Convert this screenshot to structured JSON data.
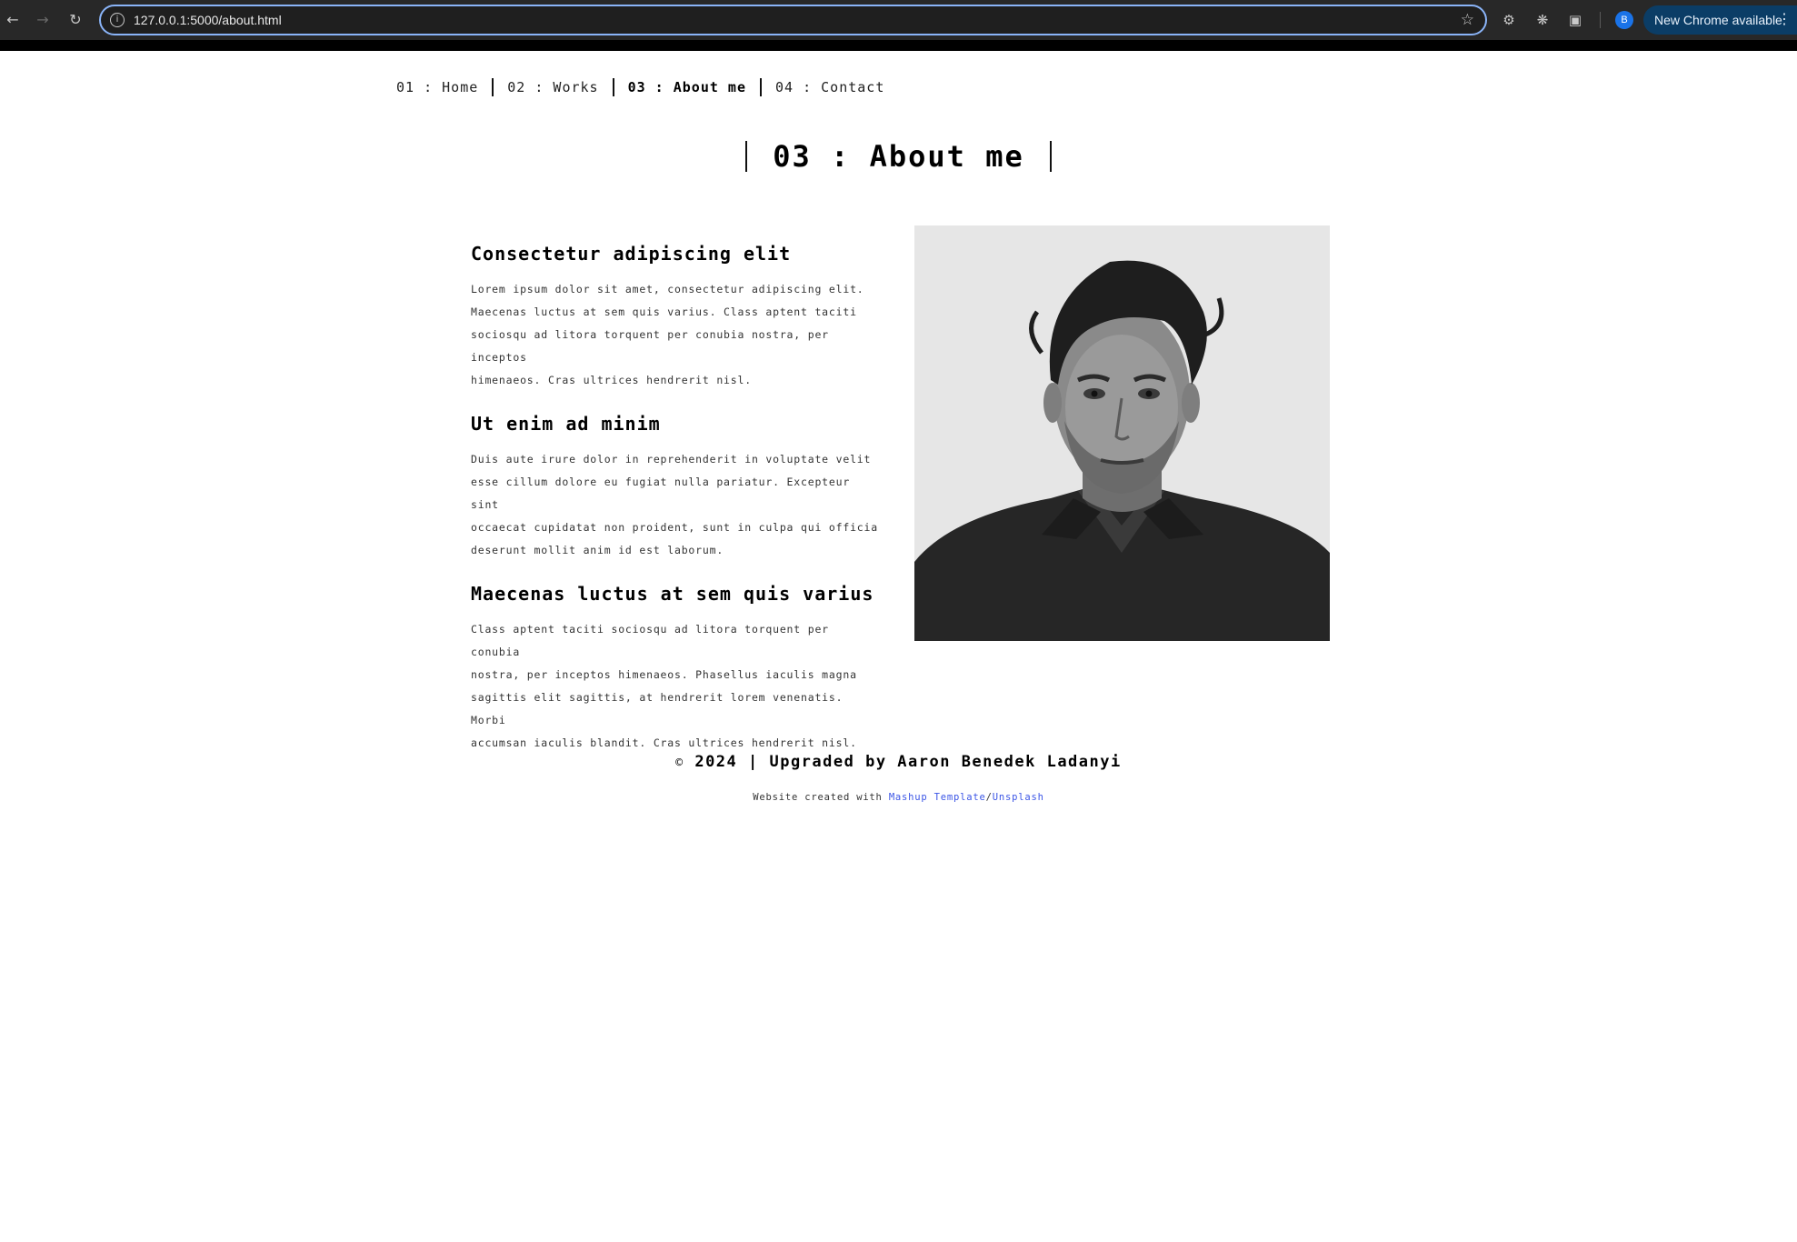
{
  "browser": {
    "url": "127.0.0.1:5000/about.html",
    "profile_initial": "B",
    "update_label": "New Chrome available",
    "icons": {
      "back": "arrow-left-icon",
      "forward": "arrow-right-icon",
      "reload": "reload-icon",
      "site_info": "info-icon",
      "bookmark": "star-icon",
      "extension_1": "gear-icon",
      "extension_2": "puzzle-dots-icon",
      "extensions": "puzzle-icon",
      "menu": "menu-dots-icon"
    },
    "accent_color": "#8ab4f8",
    "update_color": "#0b3d66"
  },
  "nav": {
    "items": [
      {
        "label": "01 : Home",
        "active": false
      },
      {
        "label": "02 : Works",
        "active": false
      },
      {
        "label": "03 : About me",
        "active": true
      },
      {
        "label": "04 : Contact",
        "active": false
      }
    ]
  },
  "page": {
    "title": "03 : About me"
  },
  "sections": [
    {
      "heading": "Consectetur adipiscing elit",
      "body": "Lorem ipsum dolor sit amet, consectetur adipiscing elit.\nMaecenas luctus at sem quis varius. Class aptent taciti\nsociosqu ad litora torquent per conubia nostra, per inceptos\nhimenaeos. Cras ultrices hendrerit nisl."
    },
    {
      "heading": "Ut enim ad minim",
      "body": "Duis aute irure dolor in reprehenderit in voluptate velit\nesse cillum dolore eu fugiat nulla pariatur. Excepteur sint\noccaecat cupidatat non proident, sunt in culpa qui officia\ndeserunt mollit anim id est laborum."
    },
    {
      "heading": "Maecenas luctus at sem quis varius",
      "body": "Class aptent taciti sociosqu ad litora torquent per conubia\nnostra, per inceptos himenaeos. Phasellus iaculis magna\nsagittis elit sagittis, at hendrerit lorem venenatis. Morbi\naccumsan iaculis blandit. Cras ultrices hendrerit nisl."
    }
  ],
  "footer": {
    "copyright_symbol": "©",
    "title": "2024 | Upgraded by Aaron Benedek Ladanyi",
    "credit_prefix": "Website created with ",
    "credit_link_1": "Mashup Template",
    "credit_separator": "/",
    "credit_link_2": "Unsplash",
    "link_color": "#3b55e6"
  }
}
